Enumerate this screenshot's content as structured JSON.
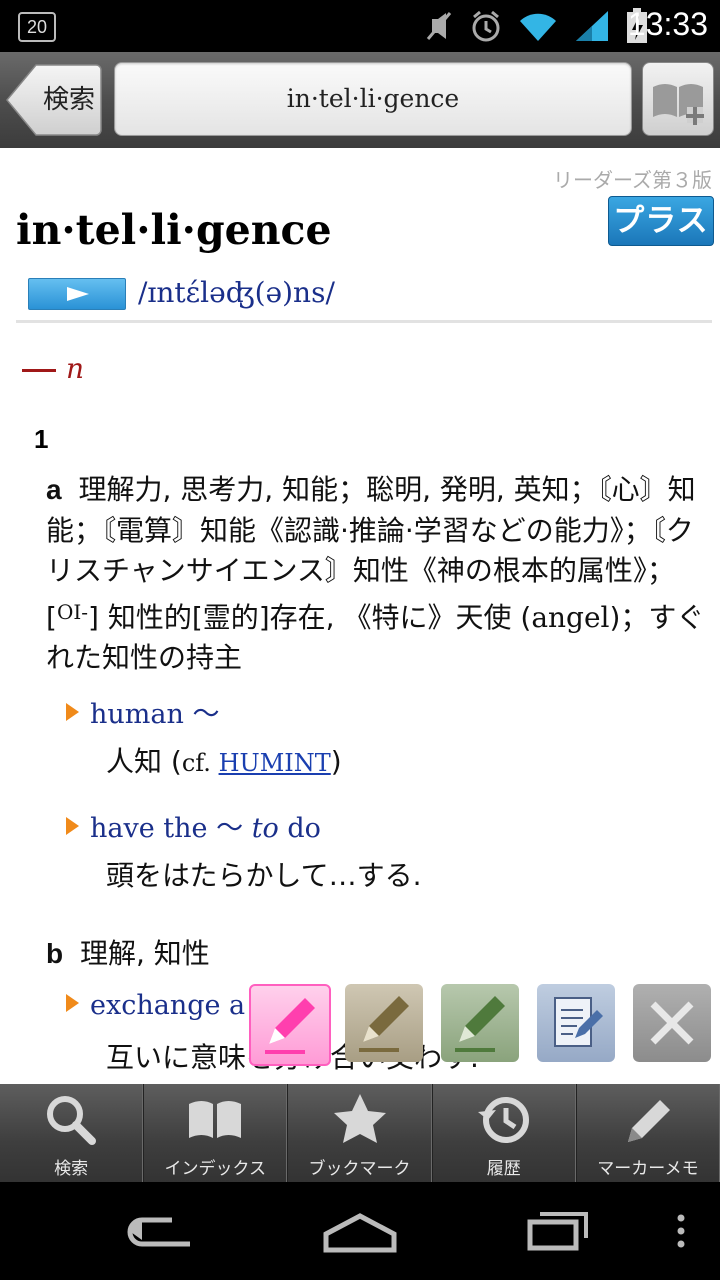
{
  "status_bar": {
    "badge": "20",
    "time": "13:33"
  },
  "toolbar": {
    "back_label": "検索",
    "search_value": "in·tel·li·gence"
  },
  "entry": {
    "source": "リーダーズ第３版",
    "plus_badge": "プラス",
    "headword": "in·tel·li·gence",
    "pronunciation": "/ɪntέləʤ(ə)ns/",
    "pos": "n",
    "sense_number": "1",
    "sense_a_label": "a",
    "sense_a_text_1": " 理解力, 思考力, 知能；聡明, 発明, 英知；〘心〙知能；〘電算〙知能《認識·推論·学習などの能力》；〘クリスチャンサイエンス〙知性《神の根本的属性》；[",
    "sense_a_bracket": "OI-",
    "sense_a_text_2": "] 知性的[霊的]存在, 《特に》天使 (",
    "sense_a_angel": "angel",
    "sense_a_text_3": ")；すぐれた知性の持主",
    "ex1_phrase": "human 〜",
    "ex1_trans_pre": "人知 (",
    "ex1_cf": "cf. ",
    "ex1_link": "HUMINT",
    "ex1_trans_post": ")",
    "ex2_phrase_1": "have the 〜 ",
    "ex2_phrase_to": "to",
    "ex2_phrase_2": " do",
    "ex2_trans": "頭をはたらかして…する.",
    "sense_b_label": "b",
    "sense_b_text": " 理解, 知性",
    "ex3_phrase": "exchange a bit of",
    "ex3_trans": "互いに意味を分け合い交わす."
  },
  "markers": [
    "pink-marker-icon",
    "brown-marker-icon",
    "green-marker-icon",
    "memo-icon",
    "close-icon"
  ],
  "tabs": [
    {
      "label": "検索",
      "icon": "search-icon"
    },
    {
      "label": "インデックス",
      "icon": "book-icon"
    },
    {
      "label": "ブックマーク",
      "icon": "star-icon"
    },
    {
      "label": "履歴",
      "icon": "history-icon"
    },
    {
      "label": "マーカーメモ",
      "icon": "pencil-icon"
    }
  ],
  "colors": {
    "accent_blue": "#1b77b9",
    "phrase_blue": "#1a2f8a",
    "pos_red": "#a01818",
    "bullet_orange": "#f08a1a"
  }
}
